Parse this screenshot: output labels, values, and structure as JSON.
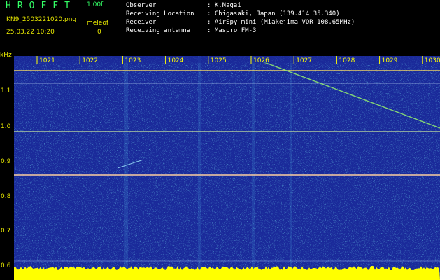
{
  "header": {
    "app_title": "HROFFT",
    "version": "1.00f",
    "filename": "KN9_2503221020.png",
    "meteor_label": "meleof",
    "datetime": "25.03.22 10:20",
    "count": "0",
    "info": [
      {
        "label": "Observer",
        "value": ": K.Nagai"
      },
      {
        "label": "Receiving Location",
        "value": ": Chigasaki, Japan (139.414 35.340)"
      },
      {
        "label": "Receiver",
        "value": ": AirSpy mini (Miakejima VOR 108.65MHz)"
      },
      {
        "label": "Receiving antenna",
        "value": ": Maspro FM-3"
      }
    ]
  },
  "spectrogram": {
    "y_unit": "kHz",
    "y_ticks": [
      "1.1",
      "1.0",
      "0.9",
      "0.8",
      "0.7",
      "0.6"
    ],
    "x_ticks": [
      "1021",
      "1022",
      "1023",
      "1024",
      "1025",
      "1026",
      "1027",
      "1028",
      "1029",
      "1030"
    ],
    "colors": {
      "background": "#1a2a9a",
      "noise_hi": "#3ad0e8",
      "baseline": "#ffff00",
      "tick": "#ffff00"
    }
  }
}
